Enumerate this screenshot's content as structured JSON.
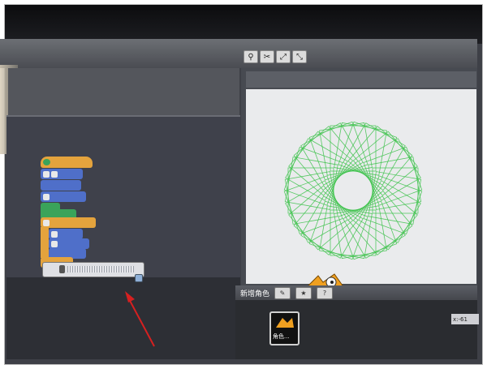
{
  "stage_toolbar": {
    "icons": [
      "stamp-icon",
      "scissors-icon",
      "grow-icon",
      "shrink-icon"
    ],
    "glyphs": [
      "⚲",
      "✂",
      "⤢",
      "⤡"
    ]
  },
  "scripts": {
    "slider_value_label": ""
  },
  "sprites_panel": {
    "title": "新增角色",
    "buttons": [
      "✎",
      "★",
      "?"
    ],
    "coords_readout": "x:-61",
    "sprite_name": "角色..."
  },
  "drawing": {
    "pen_color": "#3cc24a",
    "repeat_circles": 36
  }
}
